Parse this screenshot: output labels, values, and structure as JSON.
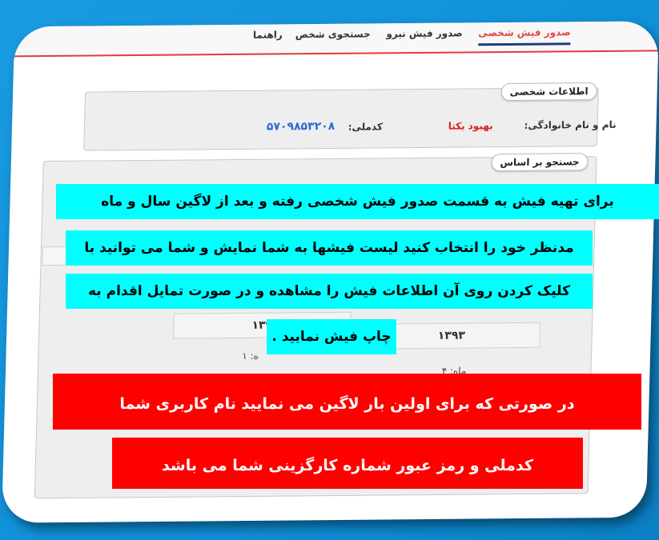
{
  "tabs": [
    {
      "label": "صدور فیش شخصی",
      "active": true
    },
    {
      "label": "صدور فیش نیرو",
      "active": false
    },
    {
      "label": "جستجوی شخص",
      "active": false
    },
    {
      "label": "راهنما",
      "active": false
    }
  ],
  "personal_info": {
    "legend": "اطلاعات شخصی",
    "name_label": "نام و نام خانوادگی:",
    "name_value": "بهبود یکتا",
    "code_label": "کدملی:",
    "code_value": "۵۷۰۹۸۵۳۲۰۸"
  },
  "search": {
    "legend": "جستجو بر اساس"
  },
  "results": {
    "year_right": "۱۳۹۳",
    "year_left": "۱۳۹",
    "month_right": "ماه: ۴",
    "month_left": "ه: ۱"
  },
  "instruction_lines": [
    "برای تهیه فیش به قسمت صدور فیش شخصی رفته و بعد از لاگین سال و ماه",
    "مدنظر خود را انتخاب کنید لیست فیشها به شما نمایش و شما می توانید با",
    "کلیک کردن روی آن اطلاعات فیش را مشاهده و در صورت تمایل اقدام به",
    "چاپ فیش نمایید ."
  ],
  "warning_lines": [
    "در صورتی که برای اولین بار لاگین می نمایید نام کاربری شما",
    "کدملی و رمز عبور شماره کارگزینی شما می باشد"
  ],
  "colors": {
    "background_blue": "#1a9be0",
    "active_tab": "#e44848",
    "highlight_cyan": "#00ffff",
    "warning_red": "#ff0000"
  }
}
